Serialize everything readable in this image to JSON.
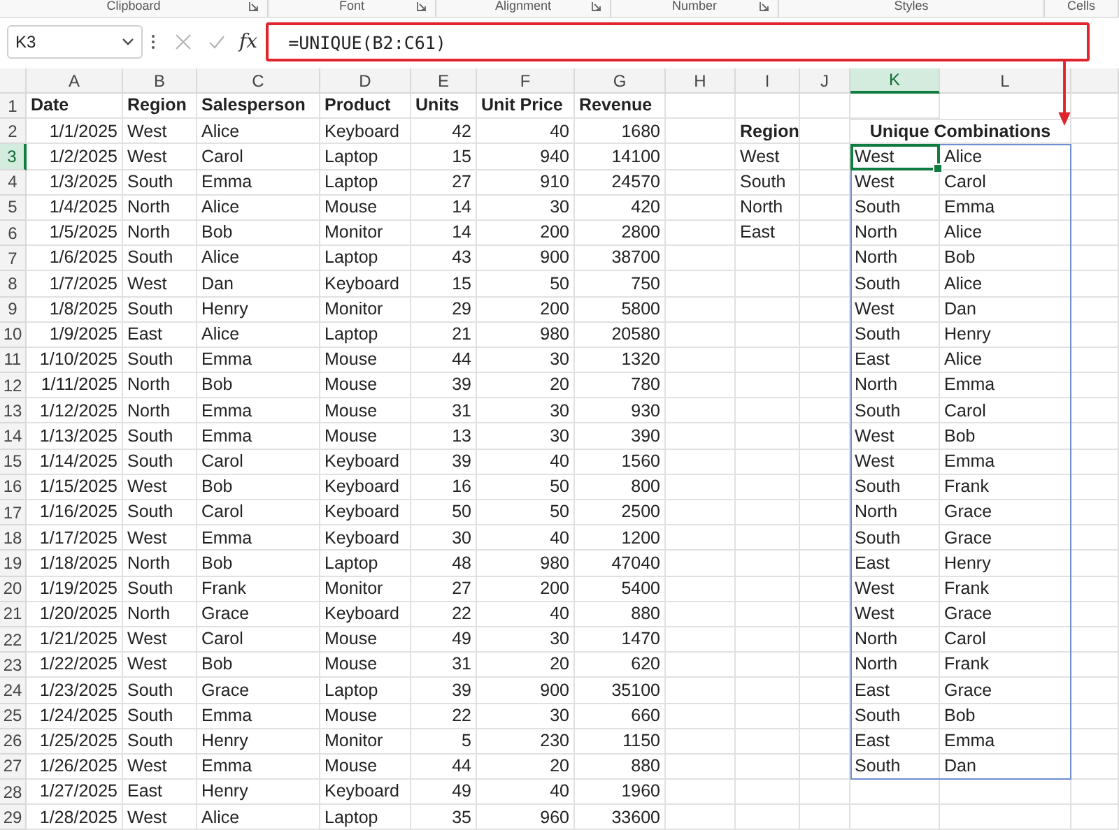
{
  "ribbon_groups": [
    {
      "label": "Clipboard",
      "launcher": true
    },
    {
      "label": "Font",
      "launcher": true
    },
    {
      "label": "Alignment",
      "launcher": true
    },
    {
      "label": "Number",
      "launcher": true
    },
    {
      "label": "Styles",
      "launcher": false
    },
    {
      "label": "Cells",
      "launcher": false
    }
  ],
  "formula_bar": {
    "name_box": "K3",
    "function_label": "fx",
    "formula": "=UNIQUE(B2:C61)"
  },
  "columns": [
    {
      "label": "A",
      "selected": false
    },
    {
      "label": "B",
      "selected": false
    },
    {
      "label": "C",
      "selected": false
    },
    {
      "label": "D",
      "selected": false
    },
    {
      "label": "E",
      "selected": false
    },
    {
      "label": "F",
      "selected": false
    },
    {
      "label": "G",
      "selected": false
    },
    {
      "label": "H",
      "selected": false
    },
    {
      "label": "I",
      "selected": false
    },
    {
      "label": "J",
      "selected": false
    },
    {
      "label": "K",
      "selected": true
    },
    {
      "label": "L",
      "selected": false
    }
  ],
  "row_headers": [
    {
      "label": "1",
      "selected": false
    },
    {
      "label": "2",
      "selected": false
    },
    {
      "label": "3",
      "selected": true
    },
    {
      "label": "4",
      "selected": false
    },
    {
      "label": "5",
      "selected": false
    },
    {
      "label": "6",
      "selected": false
    },
    {
      "label": "7",
      "selected": false
    },
    {
      "label": "8",
      "selected": false
    },
    {
      "label": "9",
      "selected": false
    },
    {
      "label": "10",
      "selected": false
    },
    {
      "label": "11",
      "selected": false
    },
    {
      "label": "12",
      "selected": false
    },
    {
      "label": "13",
      "selected": false
    },
    {
      "label": "14",
      "selected": false
    },
    {
      "label": "15",
      "selected": false
    },
    {
      "label": "16",
      "selected": false
    },
    {
      "label": "17",
      "selected": false
    },
    {
      "label": "18",
      "selected": false
    },
    {
      "label": "19",
      "selected": false
    },
    {
      "label": "20",
      "selected": false
    },
    {
      "label": "21",
      "selected": false
    },
    {
      "label": "22",
      "selected": false
    },
    {
      "label": "23",
      "selected": false
    },
    {
      "label": "24",
      "selected": false
    },
    {
      "label": "25",
      "selected": false
    },
    {
      "label": "26",
      "selected": false
    },
    {
      "label": "27",
      "selected": false
    },
    {
      "label": "28",
      "selected": false
    },
    {
      "label": "29",
      "selected": false
    }
  ],
  "sales_table": {
    "headers": [
      "Date",
      "Region",
      "Salesperson",
      "Product",
      "Units",
      "Unit Price",
      "Revenue"
    ],
    "rows": [
      [
        "1/1/2025",
        "West",
        "Alice",
        "Keyboard",
        "42",
        "40",
        "1680"
      ],
      [
        "1/2/2025",
        "West",
        "Carol",
        "Laptop",
        "15",
        "940",
        "14100"
      ],
      [
        "1/3/2025",
        "South",
        "Emma",
        "Laptop",
        "27",
        "910",
        "24570"
      ],
      [
        "1/4/2025",
        "North",
        "Alice",
        "Mouse",
        "14",
        "30",
        "420"
      ],
      [
        "1/5/2025",
        "North",
        "Bob",
        "Monitor",
        "14",
        "200",
        "2800"
      ],
      [
        "1/6/2025",
        "South",
        "Alice",
        "Laptop",
        "43",
        "900",
        "38700"
      ],
      [
        "1/7/2025",
        "West",
        "Dan",
        "Keyboard",
        "15",
        "50",
        "750"
      ],
      [
        "1/8/2025",
        "South",
        "Henry",
        "Monitor",
        "29",
        "200",
        "5800"
      ],
      [
        "1/9/2025",
        "East",
        "Alice",
        "Laptop",
        "21",
        "980",
        "20580"
      ],
      [
        "1/10/2025",
        "South",
        "Emma",
        "Mouse",
        "44",
        "30",
        "1320"
      ],
      [
        "1/11/2025",
        "North",
        "Bob",
        "Mouse",
        "39",
        "20",
        "780"
      ],
      [
        "1/12/2025",
        "North",
        "Emma",
        "Mouse",
        "31",
        "30",
        "930"
      ],
      [
        "1/13/2025",
        "South",
        "Emma",
        "Mouse",
        "13",
        "30",
        "390"
      ],
      [
        "1/14/2025",
        "South",
        "Carol",
        "Keyboard",
        "39",
        "40",
        "1560"
      ],
      [
        "1/15/2025",
        "West",
        "Bob",
        "Keyboard",
        "16",
        "50",
        "800"
      ],
      [
        "1/16/2025",
        "South",
        "Carol",
        "Keyboard",
        "50",
        "50",
        "2500"
      ],
      [
        "1/17/2025",
        "West",
        "Emma",
        "Keyboard",
        "30",
        "40",
        "1200"
      ],
      [
        "1/18/2025",
        "North",
        "Bob",
        "Laptop",
        "48",
        "980",
        "47040"
      ],
      [
        "1/19/2025",
        "South",
        "Frank",
        "Monitor",
        "27",
        "200",
        "5400"
      ],
      [
        "1/20/2025",
        "North",
        "Grace",
        "Keyboard",
        "22",
        "40",
        "880"
      ],
      [
        "1/21/2025",
        "West",
        "Carol",
        "Mouse",
        "49",
        "30",
        "1470"
      ],
      [
        "1/22/2025",
        "West",
        "Bob",
        "Mouse",
        "31",
        "20",
        "620"
      ],
      [
        "1/23/2025",
        "South",
        "Grace",
        "Laptop",
        "39",
        "900",
        "35100"
      ],
      [
        "1/24/2025",
        "South",
        "Emma",
        "Mouse",
        "22",
        "30",
        "660"
      ],
      [
        "1/25/2025",
        "South",
        "Henry",
        "Monitor",
        "5",
        "230",
        "1150"
      ],
      [
        "1/26/2025",
        "West",
        "Emma",
        "Mouse",
        "44",
        "20",
        "880"
      ],
      [
        "1/27/2025",
        "East",
        "Henry",
        "Keyboard",
        "49",
        "40",
        "1960"
      ],
      [
        "1/28/2025",
        "West",
        "Alice",
        "Laptop",
        "35",
        "960",
        "33600"
      ]
    ]
  },
  "region_list": {
    "heading": "Region",
    "values": [
      "West",
      "South",
      "North",
      "East"
    ]
  },
  "unique_combinations": {
    "heading": "Unique Combinations",
    "rows": [
      [
        "West",
        "Alice"
      ],
      [
        "West",
        "Carol"
      ],
      [
        "South",
        "Emma"
      ],
      [
        "North",
        "Alice"
      ],
      [
        "North",
        "Bob"
      ],
      [
        "South",
        "Alice"
      ],
      [
        "West",
        "Dan"
      ],
      [
        "South",
        "Henry"
      ],
      [
        "East",
        "Alice"
      ],
      [
        "North",
        "Emma"
      ],
      [
        "South",
        "Carol"
      ],
      [
        "West",
        "Bob"
      ],
      [
        "West",
        "Emma"
      ],
      [
        "South",
        "Frank"
      ],
      [
        "North",
        "Grace"
      ],
      [
        "South",
        "Grace"
      ],
      [
        "East",
        "Henry"
      ],
      [
        "West",
        "Frank"
      ],
      [
        "West",
        "Grace"
      ],
      [
        "North",
        "Carol"
      ],
      [
        "North",
        "Frank"
      ],
      [
        "East",
        "Grace"
      ],
      [
        "South",
        "Bob"
      ],
      [
        "East",
        "Emma"
      ],
      [
        "South",
        "Dan"
      ]
    ]
  }
}
